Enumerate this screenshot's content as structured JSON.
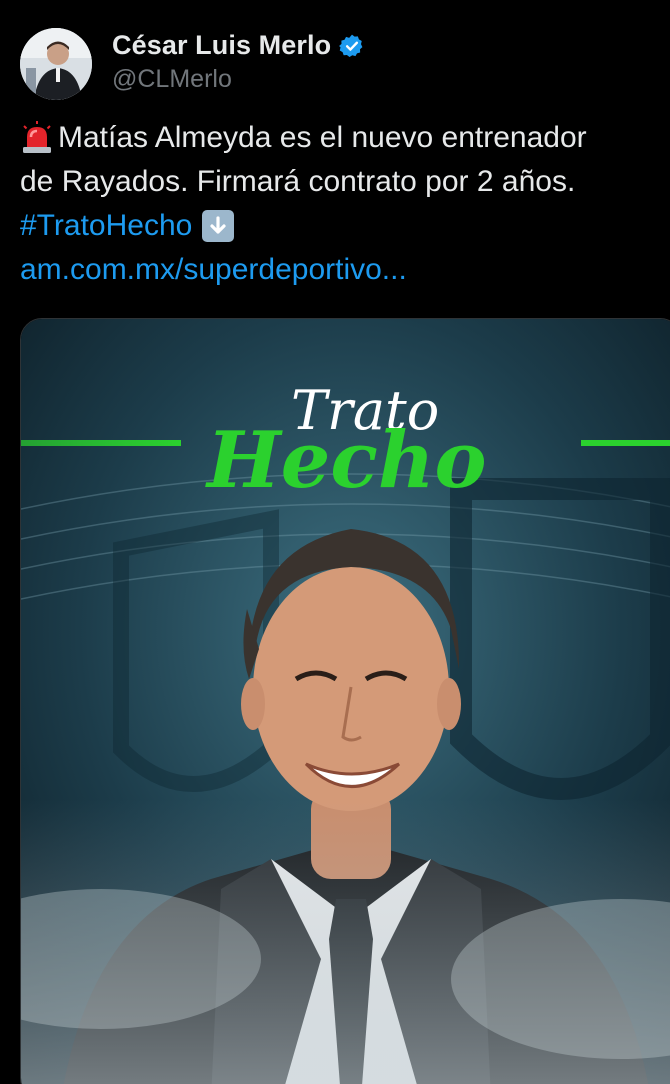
{
  "author": {
    "display_name": "César Luis Merlo",
    "handle": "@CLMerlo",
    "verified_icon": "verified-badge-icon",
    "avatar_icon": "avatar"
  },
  "tweet": {
    "line1_text": "Matías Almeyda es el nuevo entrenador",
    "line2_text": "de Rayados. Firmará contrato por 2 años.",
    "hashtag": "#TratoHecho",
    "link": "am.com.mx/superdeportivo...",
    "emoji_siren": "police-light-icon",
    "emoji_arrow": "down-arrow-icon"
  },
  "media": {
    "headline_top": "Trato",
    "headline_bottom": "Hecho"
  },
  "colors": {
    "background": "#000000",
    "text": "#e7e9ea",
    "muted": "#71767b",
    "link": "#1d9bf0",
    "accent_green": "#2bd12e"
  }
}
